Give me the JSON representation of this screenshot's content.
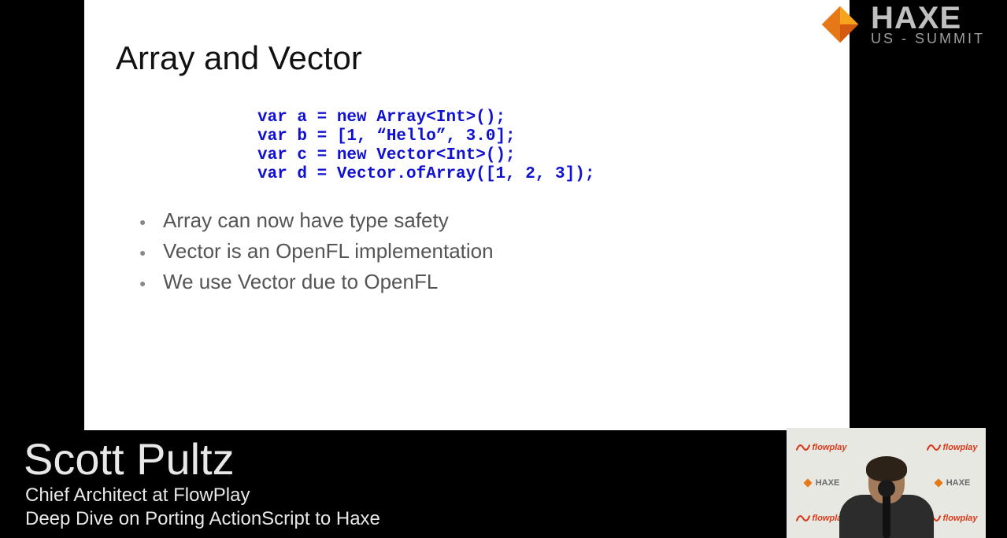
{
  "slide": {
    "title": "Array and Vector",
    "code": {
      "line1": "var a = new Array<Int>();",
      "line2": "var b = [1, “Hello”, 3.0];",
      "line3": "var c = new Vector<Int>();",
      "line4": "var d = Vector.ofArray([1, 2, 3]);"
    },
    "bullets": [
      "Array can now have type safety",
      "Vector is an OpenFL implementation",
      "We use Vector due to OpenFL"
    ]
  },
  "branding": {
    "haxe": "HAXE",
    "summit": "US - SUMMIT"
  },
  "lower_third": {
    "name": "Scott Pultz",
    "role": "Chief Architect at FlowPlay",
    "talk": "Deep Dive on Porting ActionScript to Haxe"
  },
  "camera": {
    "chip_haxe": "HAXE",
    "chip_flowplay": "flowplay"
  }
}
